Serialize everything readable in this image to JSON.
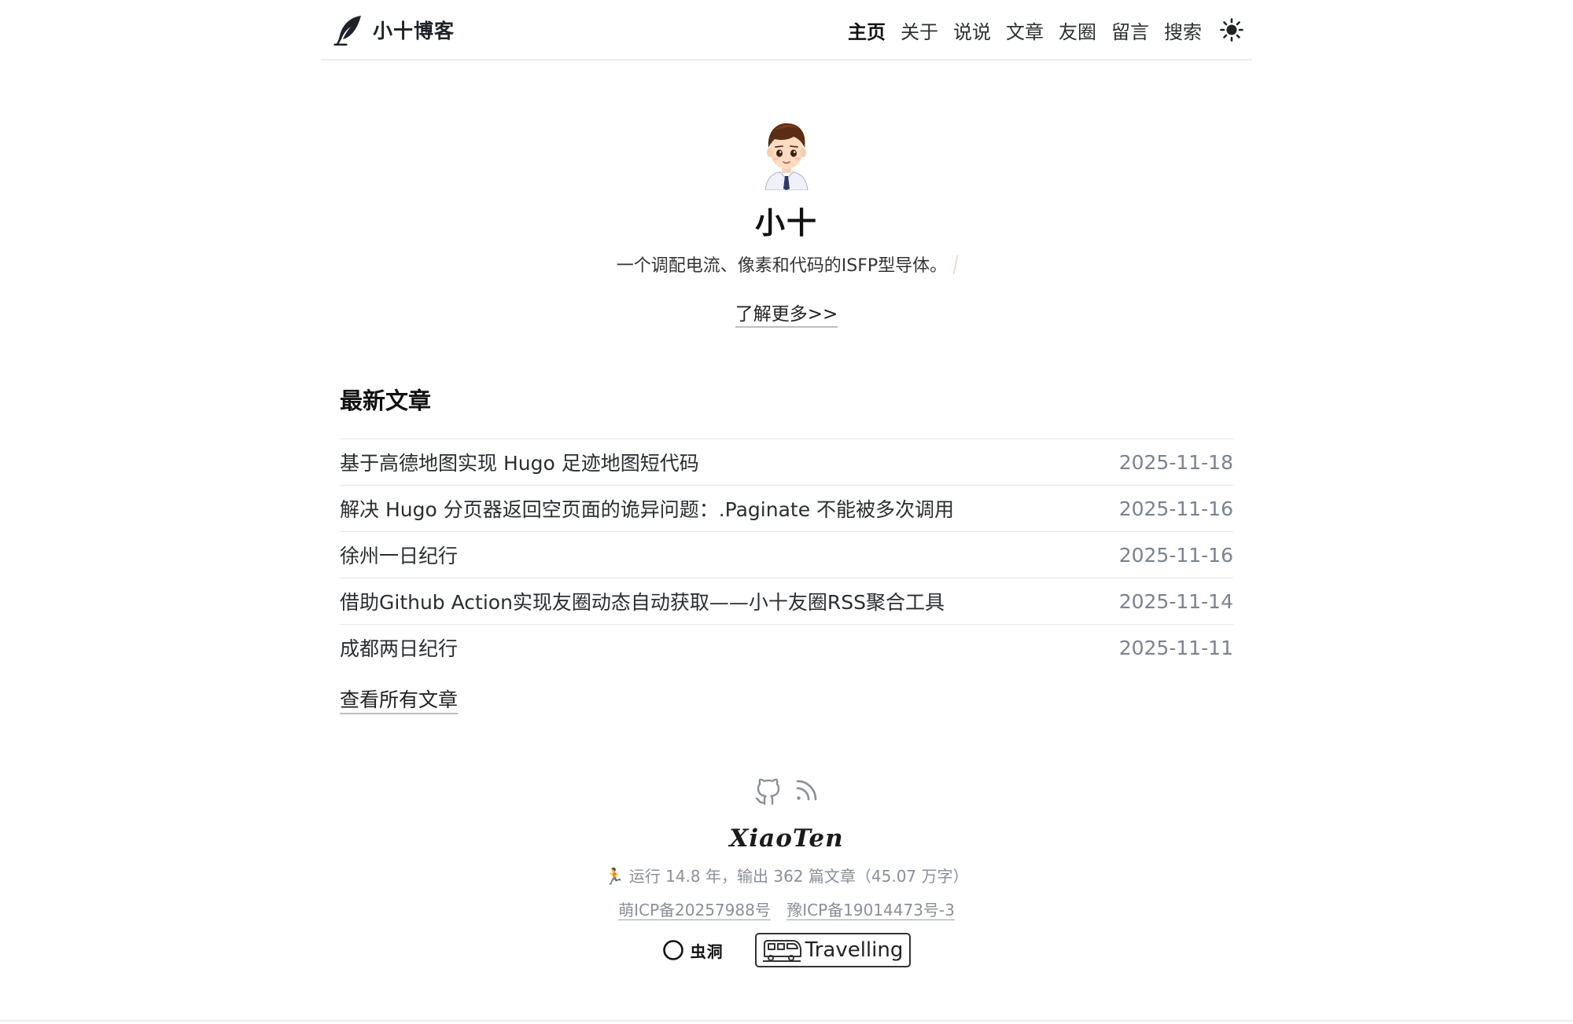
{
  "header": {
    "brand_title": "小十博客",
    "nav": [
      {
        "label": "主页",
        "active": true
      },
      {
        "label": "关于",
        "active": false
      },
      {
        "label": "说说",
        "active": false
      },
      {
        "label": "文章",
        "active": false
      },
      {
        "label": "友圈",
        "active": false
      },
      {
        "label": "留言",
        "active": false
      },
      {
        "label": "搜索",
        "active": false
      }
    ],
    "theme_toggle_icon": "sun-icon"
  },
  "profile": {
    "name": "小十",
    "bio": "一个调配电流、像素和代码的ISFP型导体。",
    "learn_more": "了解更多>>"
  },
  "latest": {
    "title": "最新文章",
    "posts": [
      {
        "title": "基于高德地图实现 Hugo 足迹地图短代码",
        "date": "2025-11-18"
      },
      {
        "title": "解决 Hugo 分页器返回空页面的诡异问题：.Paginate 不能被多次调用",
        "date": "2025-11-16"
      },
      {
        "title": "徐州一日纪行",
        "date": "2025-11-16"
      },
      {
        "title": "借助Github Action实现友圈动态自动获取——小十友圈RSS聚合工具",
        "date": "2025-11-14"
      },
      {
        "title": "成都两日纪行",
        "date": "2025-11-11"
      }
    ],
    "view_all": "查看所有文章"
  },
  "footer": {
    "social_icons": [
      "github-icon",
      "rss-icon"
    ],
    "signature": "XiaoTen",
    "stats_emoji": "🏃",
    "stats": "运行 14.8 年，输出 362 篇文章（45.07 万字）",
    "icp": [
      "萌ICP备20257988号",
      "豫ICP备19014473号-3"
    ],
    "badges": {
      "chongdong": "虫洞",
      "travelling": "Travelling"
    }
  },
  "colors": {
    "text": "#1f2329",
    "muted": "#8a8f98",
    "date": "#7b8290",
    "divider": "#e6e6e6"
  }
}
